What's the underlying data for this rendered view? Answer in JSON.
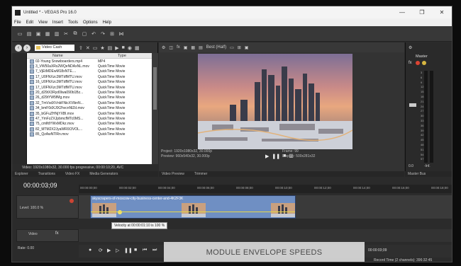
{
  "window": {
    "title": "Untitled * - VEGAS Pro 16.0",
    "buttons": [
      "—",
      "❐",
      "✕"
    ]
  },
  "menu": [
    "File",
    "Edit",
    "View",
    "Insert",
    "Tools",
    "Options",
    "Help"
  ],
  "explorer": {
    "path": "Video Cash",
    "columns": [
      "Name",
      "Type"
    ],
    "files": [
      {
        "name": "02-Young Snowboarders.mp4",
        "type": "MP4"
      },
      {
        "name": "3_VW50aXRs2WQeNDAxNL.mov",
        "type": "QuickTime Movie"
      },
      {
        "name": "7_VjEtMDEwM18xNTE....",
        "type": "QuickTime Movie"
      },
      {
        "name": "17_U0FNXzc3MTdfMTU.mov",
        "type": "QuickTime Movie"
      },
      {
        "name": "16_U0FNXzc3MTdfMTU.mov",
        "type": "QuickTime Movie"
      },
      {
        "name": "17_U0FNXzc3MTdfMTU.mov",
        "type": "QuickTime Movie"
      },
      {
        "name": "20_d29tX3Ryd0lwa090b1Bz...",
        "type": "QuickTime Movie"
      },
      {
        "name": "26_d29tYW5fMg.mov",
        "type": "QuickTime Movie"
      },
      {
        "name": "32_TmVsdXVnbFNicXVlbnN...",
        "type": "QuickTime Movie"
      },
      {
        "name": "34_bmF0dXJlX2hvcnNlZd.mov",
        "type": "QuickTime Movie"
      },
      {
        "name": "35_bGFuZHNjYXBl.mov",
        "type": "QuickTime Movie"
      },
      {
        "name": "47_YmFzZXJpbmcfMTc0MS...",
        "type": "QuickTime Movie"
      },
      {
        "name": "75_cmlfdYWxMDkz.mov",
        "type": "QuickTime Movie"
      },
      {
        "name": "82_MTM2X2JyaWRlX3VOL...",
        "type": "QuickTime Movie"
      },
      {
        "name": "85_QzAwNTlRn.mov",
        "type": "QuickTime Movie"
      }
    ],
    "status": "Video: 1920x1080x32, 30.000 fps progressive, 00:00:10;20, AVC",
    "tabs": [
      "Explorer",
      "Transitions",
      "Video FX",
      "Media Generators"
    ]
  },
  "preview": {
    "quality": "Best (Half)",
    "project": "Project:   1920x1080x32, 30.000p",
    "preview_res": "Preview:   960x540x32, 30.000p",
    "frame": "Frame:     99",
    "display": "Display:   500x281x32",
    "tabs": [
      "Video Preview",
      "Trimmer"
    ]
  },
  "master": {
    "label": "Master",
    "ticks": [
      "3",
      "6",
      "9",
      "12",
      "15",
      "18",
      "21",
      "24",
      "27",
      "30",
      "33",
      "36",
      "39",
      "42",
      "45",
      "48",
      "51",
      "54",
      "57"
    ],
    "fader_value": "0.0",
    "peak": "-Inf.",
    "tab": "Master Bus"
  },
  "timeline": {
    "timecode": "00:00:03;09",
    "ruler_marks": [
      "00:00:00;00",
      "00:00:02;00",
      "00:00:04;00",
      "00:00:06;00",
      "00:00:08;00",
      "00:00:10;00",
      "00:00:12;00",
      "00:00:14;00",
      "00:00:16;00",
      "00:00:18;00"
    ],
    "track1": {
      "level": "Level: 100.0 %",
      "clip_name": "skyscrapers-of-moscow-city-business-center-and-4K2F3K"
    },
    "track2_label": "Video",
    "velocity_tooltip": "Velocity at 00:00:01:10 is 100 %",
    "rate": "Rate: 0.00",
    "end_time": "00:00:03;09",
    "record_time": "Record Time (2 channels): 396:32:45"
  },
  "overlay_text": "MODULE ENVELOPE SPEEDS"
}
